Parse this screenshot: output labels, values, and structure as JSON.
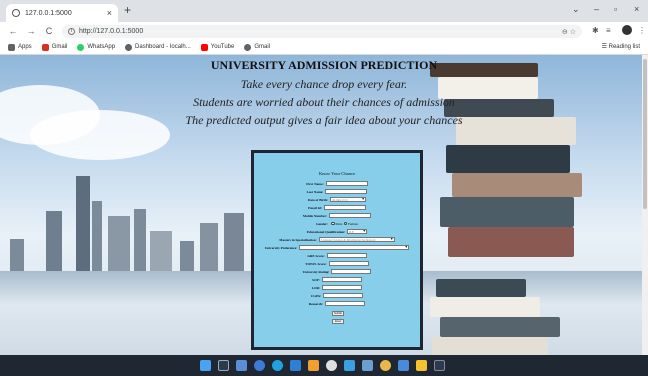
{
  "browser": {
    "tab_title": "127.0.0.1:5000",
    "url": "http://127.0.0.1:5000",
    "bookmarks": [
      {
        "label": "Apps",
        "color": "#5f6368"
      },
      {
        "label": "Gmail",
        "color": "#d93025"
      },
      {
        "label": "WhatsApp",
        "color": "#25d366"
      },
      {
        "label": "Dashboard - Iocalh...",
        "color": "#5f6368"
      },
      {
        "label": "YouTube",
        "color": "#ff0000"
      },
      {
        "label": "Gmail",
        "color": "#5f6368"
      }
    ],
    "reading_list": "Reading list"
  },
  "page": {
    "heading": "UNIVERSITY ADMISSION PREDICTION",
    "taglines": [
      "Take every chance drop every fear.",
      "Students are worried about their chances of admission",
      "The predicted output gives a fair idea about your chances"
    ]
  },
  "form": {
    "title": "Know Your Chance",
    "first_name_label": "First Name:",
    "last_name_label": "Last Name:",
    "dob_label": "Date of Birth:",
    "dob_placeholder": "dd-mm-yyyy",
    "email_label": "Email Id:",
    "mobile_label": "Mobile Number:",
    "gender_label": "Gender:",
    "gender_options": [
      "Male",
      "Female"
    ],
    "edu_label": "Educational Qualification:",
    "edu_value": "B.E",
    "spec_label": "Masters in Specialization:",
    "spec_value": "Computer Science & Information Technology",
    "univ_pref_label": "University Preference:",
    "univ_pref_value": "",
    "gre_label": "GRE Score:",
    "toefl_label": "TOEFL Score:",
    "univ_rating_label": "University Rating:",
    "sop_label": "SOP:",
    "lor_label": "LOR:",
    "cgpa_label": "CGPA:",
    "research_label": "Research:",
    "submit_label": "Submit",
    "reset_label": "Reset"
  },
  "colors": {
    "form_bg": "#87ceeb",
    "form_border": "#1e2633"
  }
}
